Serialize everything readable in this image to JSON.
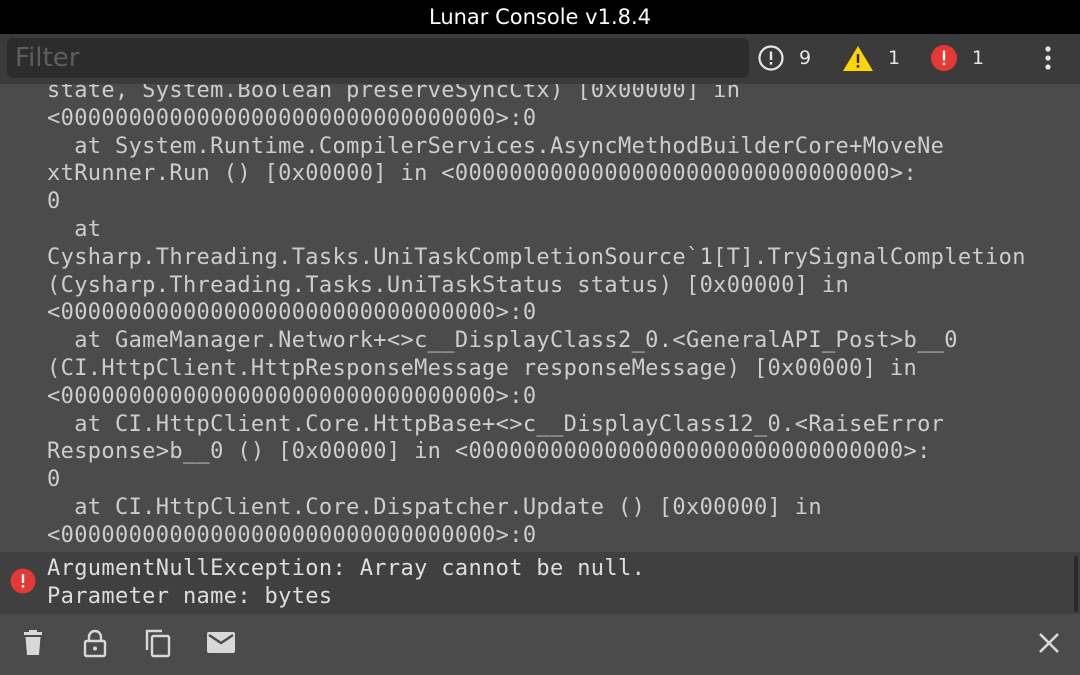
{
  "window": {
    "title": "Lunar Console v1.8.4"
  },
  "toolbar": {
    "filter_placeholder": "Filter",
    "filter_value": "",
    "log_count": "9",
    "warning_count": "1",
    "error_count": "1",
    "menu_icon": "more-vert-icon"
  },
  "log_lines": [
    "state, System.Boolean preserveSyncCtx) [0x00000] in",
    "<00000000000000000000000000000000>:0",
    "  at System.Runtime.CompilerServices.AsyncMethodBuilderCore+MoveNe",
    "xtRunner.Run () [0x00000] in <00000000000000000000000000000000>:",
    "0",
    "  at",
    "Cysharp.Threading.Tasks.UniTaskCompletionSource`1[T].TrySignalCompletion",
    "(Cysharp.Threading.Tasks.UniTaskStatus status) [0x00000] in",
    "<00000000000000000000000000000000>:0",
    "  at GameManager.Network+<>c__DisplayClass2_0.<GeneralAPI_Post>b__0",
    "(CI.HttpClient.HttpResponseMessage responseMessage) [0x00000] in",
    "<00000000000000000000000000000000>:0",
    "  at CI.HttpClient.Core.HttpBase+<>c__DisplayClass12_0.<RaiseError",
    "Response>b__0 () [0x00000] in <00000000000000000000000000000000>:",
    "0",
    "  at CI.HttpClient.Core.Dispatcher.Update () [0x00000] in",
    "<00000000000000000000000000000000>:0"
  ],
  "detail": {
    "line1": "ArgumentNullException: Array cannot be null.",
    "line2": "Parameter name: bytes"
  },
  "bottom_bar": {
    "icons": [
      "trash-icon",
      "lock-icon",
      "copy-icon",
      "mail-icon",
      "close-icon"
    ]
  },
  "colors": {
    "background": "#4b4b4b",
    "toolbar": "#3b3b3b",
    "filter_bg": "#2c2c2c",
    "error_red": "#e53935",
    "warning_yellow": "#ffd600",
    "text": "#cdcdcd"
  }
}
